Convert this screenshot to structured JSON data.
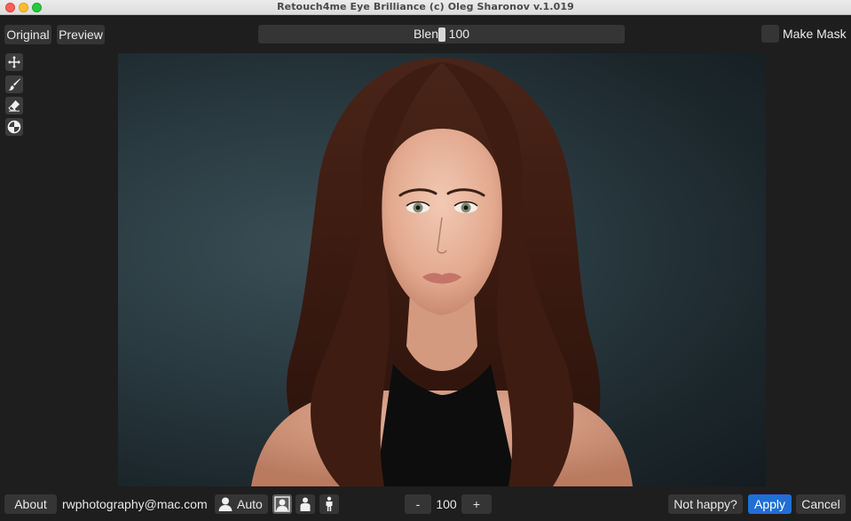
{
  "window": {
    "title": "Retouch4me Eye Brilliance (c) Oleg Sharonov v.1.019"
  },
  "toolbar": {
    "original_label": "Original",
    "preview_label": "Preview",
    "blend_text": "Blend 100",
    "blend_value": 100,
    "blend_max": 100,
    "make_mask_label": "Make Mask",
    "make_mask_checked": false
  },
  "tools": [
    {
      "name": "move-icon"
    },
    {
      "name": "brush-icon"
    },
    {
      "name": "eraser-icon"
    },
    {
      "name": "mask-overlay-icon"
    }
  ],
  "footer": {
    "about_label": "About",
    "email": "rwphotography@mac.com",
    "auto_label": "Auto",
    "zoom_minus": "-",
    "zoom_value": "100",
    "zoom_plus": "+",
    "not_happy_label": "Not happy?",
    "apply_label": "Apply",
    "cancel_label": "Cancel"
  },
  "colors": {
    "background": "#1e1e1e",
    "button": "#353535",
    "accent": "#1f6fd6"
  }
}
